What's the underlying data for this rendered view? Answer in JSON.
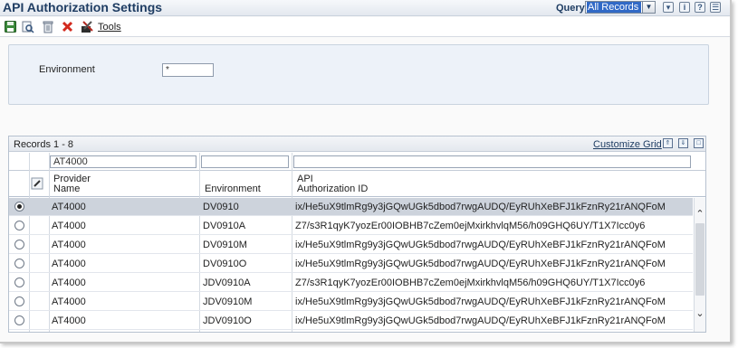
{
  "header": {
    "title": "API Authorization Settings",
    "query_label": "Query:",
    "query_value": "All Records",
    "icons": [
      "filter-icon",
      "info-icon",
      "help-icon",
      "personalize-icon"
    ]
  },
  "toolbar": {
    "save_icon": "save-icon",
    "view_icon": "view-icon",
    "delete_icon": "delete-icon",
    "close_icon": "close-icon",
    "tools_label": "Tools"
  },
  "filter": {
    "environment_label": "Environment",
    "environment_value": "*"
  },
  "grid": {
    "records_label": "Records 1 - 8",
    "customize_label": "Customize Grid",
    "qbe": {
      "provider_name": "AT4000",
      "environment": "",
      "api_auth_id": ""
    },
    "columns": {
      "provider_name": "Provider\nName",
      "environment": "Environment",
      "api_auth_id": "API\nAuthorization ID"
    },
    "rows": [
      {
        "selected": true,
        "provider": "AT4000",
        "environment": "DV0910",
        "auth_id": "ix/He5uX9tlmRg9y3jGQwUGk5dbod7rwgAUDQ/EyRUhXeBFJ1kFznRy21rANQFoM"
      },
      {
        "selected": false,
        "provider": "AT4000",
        "environment": "DV0910A",
        "auth_id": "Z7/s3R1qyK7yozEr00IOBHB7cZem0ejMxirkhvlqM56/h09GHQ6UY/T1X7Icc0y6"
      },
      {
        "selected": false,
        "provider": "AT4000",
        "environment": "DV0910M",
        "auth_id": "ix/He5uX9tlmRg9y3jGQwUGk5dbod7rwgAUDQ/EyRUhXeBFJ1kFznRy21rANQFoM"
      },
      {
        "selected": false,
        "provider": "AT4000",
        "environment": "DV0910O",
        "auth_id": "ix/He5uX9tlmRg9y3jGQwUGk5dbod7rwgAUDQ/EyRUhXeBFJ1kFznRy21rANQFoM"
      },
      {
        "selected": false,
        "provider": "AT4000",
        "environment": "JDV0910A",
        "auth_id": "Z7/s3R1qyK7yozEr00IOBHB7cZem0ejMxirkhvlqM56/h09GHQ6UY/T1X7Icc0y6"
      },
      {
        "selected": false,
        "provider": "AT4000",
        "environment": "JDV0910M",
        "auth_id": "ix/He5uX9tlmRg9y3jGQwUGk5dbod7rwgAUDQ/EyRUhXeBFJ1kFznRy21rANQFoM"
      },
      {
        "selected": false,
        "provider": "AT4000",
        "environment": "JDV0910O",
        "auth_id": "ix/He5uX9tlmRg9y3jGQwUGk5dbod7rwgAUDQ/EyRUhXeBFJ1kFznRy21rANQFoM"
      }
    ]
  },
  "colors": {
    "title": "#1f3d63",
    "selected_row": "#cdd3dc",
    "panel_bg": "#edf2f9",
    "query_highlight": "#3169c6"
  }
}
